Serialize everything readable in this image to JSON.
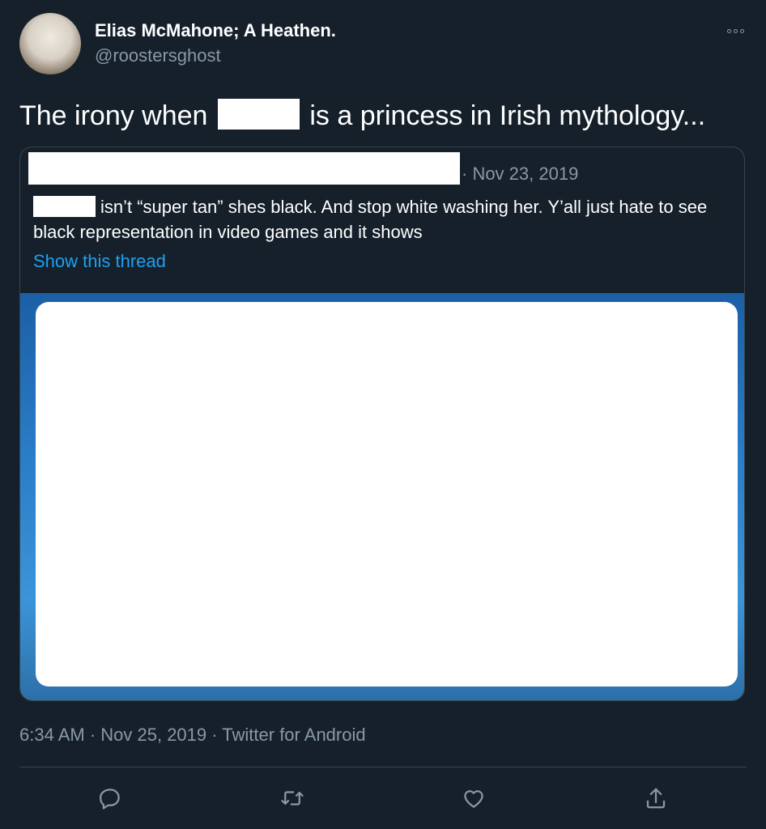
{
  "tweet": {
    "author_name": "Elias McMahone; A Heathen.",
    "author_handle": "@roostersghost",
    "text_before": "The irony when",
    "text_after": "is a princess in Irish mythology...",
    "timestamp": "6:34 AM · Nov 25, 2019 · Twitter for Android"
  },
  "quote": {
    "date": "· Nov 23, 2019",
    "text": "isn’t “super tan” shes black. And stop white washing her. Y’all just hate to see black representation in video games and it shows",
    "show_thread": "Show this thread"
  },
  "icons": {
    "more": "more-options-icon",
    "reply": "reply-icon",
    "retweet": "retweet-icon",
    "like": "like-icon",
    "share": "share-icon"
  }
}
